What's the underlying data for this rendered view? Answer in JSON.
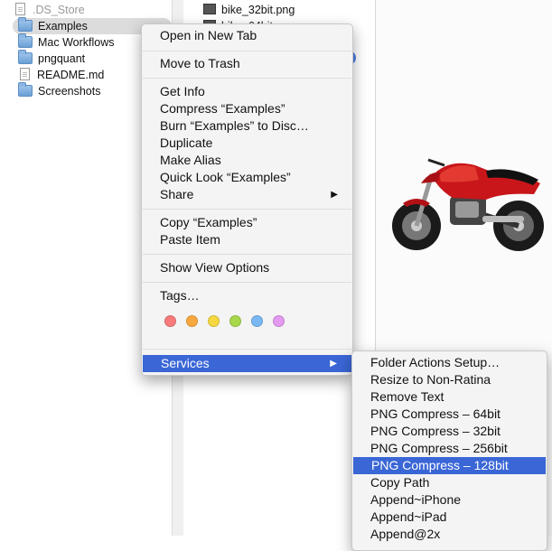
{
  "sidebar": {
    "items": [
      {
        "label": ".DS_Store",
        "icon": "document-icon"
      },
      {
        "label": "Examples",
        "icon": "folder-icon"
      },
      {
        "label": "Mac Workflows",
        "icon": "folder-icon"
      },
      {
        "label": "pngquant",
        "icon": "folder-icon"
      },
      {
        "label": "README.md",
        "icon": "document-icon"
      },
      {
        "label": "Screenshots",
        "icon": "folder-icon"
      }
    ]
  },
  "files": {
    "items": [
      {
        "label": "bike_32bit.png"
      },
      {
        "label": "bike_64bit.png"
      }
    ]
  },
  "context_menu": {
    "open_new_tab": "Open in New Tab",
    "move_to_trash": "Move to Trash",
    "get_info": "Get Info",
    "compress": "Compress “Examples”",
    "burn": "Burn “Examples” to Disc…",
    "duplicate": "Duplicate",
    "make_alias": "Make Alias",
    "quick_look": "Quick Look “Examples”",
    "share": "Share",
    "copy": "Copy “Examples”",
    "paste": "Paste Item",
    "show_view_options": "Show View Options",
    "tags": "Tags…",
    "services": "Services",
    "submenu_arrow": "▶"
  },
  "tag_colors": [
    "#f87a7a",
    "#f8a83c",
    "#f5d840",
    "#a6d84a",
    "#7ab8f5",
    "#e39af0"
  ],
  "services_menu": {
    "items": [
      "Folder Actions Setup…",
      "Resize to Non-Ratina",
      "Remove Text",
      "PNG Compress – 64bit",
      "PNG Compress – 32bit",
      "PNG Compress – 256bit",
      "PNG Compress – 128bit",
      "Copy Path",
      "Append~iPhone",
      "Append~iPad",
      "Append@2x"
    ]
  },
  "colors": {
    "highlight": "#3a66d6"
  }
}
